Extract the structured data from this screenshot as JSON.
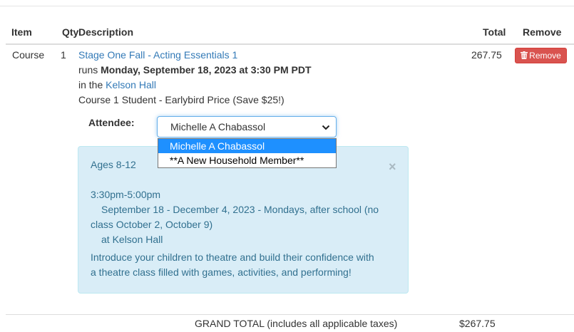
{
  "table": {
    "headers": {
      "item": "Item",
      "qty": "Qty",
      "description": "Description",
      "total": "Total",
      "remove": "Remove"
    }
  },
  "line_item": {
    "item": "Course",
    "qty": "1",
    "course_name": "Stage One Fall - Acting Essentials 1",
    "runs_prefix": "runs",
    "runs_date": "Monday, September 18, 2023 at 3:30 PM PDT",
    "in_prefix": "in the",
    "location": "Kelson Hall",
    "price_line": "Course 1 Student - Earlybird Price (Save $25!)",
    "total": "267.75",
    "remove_label": "Remove",
    "remove_icon": "trash-icon"
  },
  "attendee": {
    "label": "Attendee:",
    "selected": "Michelle A Chabassol",
    "options": [
      "Michelle A Chabassol",
      "**A New Household Member**"
    ]
  },
  "info_box": {
    "ages": "Ages 8-12",
    "close": "×",
    "time": "3:30pm-5:00pm",
    "schedule_line1": "September 18 - December 4, 2023 - Mondays, after school (no",
    "schedule_line2": "class October 2, October 9)",
    "venue": "at Kelson Hall",
    "desc_line1": "Introduce your children to theatre and build their confidence with",
    "desc_line2": "a theatre class filled with games, activities, and performing!"
  },
  "footer": {
    "grand_total_label": "GRAND TOTAL (includes all applicable taxes)",
    "grand_total_value": "$267.75"
  },
  "colors": {
    "link": "#337ab7",
    "danger": "#d9534f",
    "info_bg": "#d9edf7",
    "info_text": "#31708f",
    "selected_option": "#1e90ff"
  }
}
